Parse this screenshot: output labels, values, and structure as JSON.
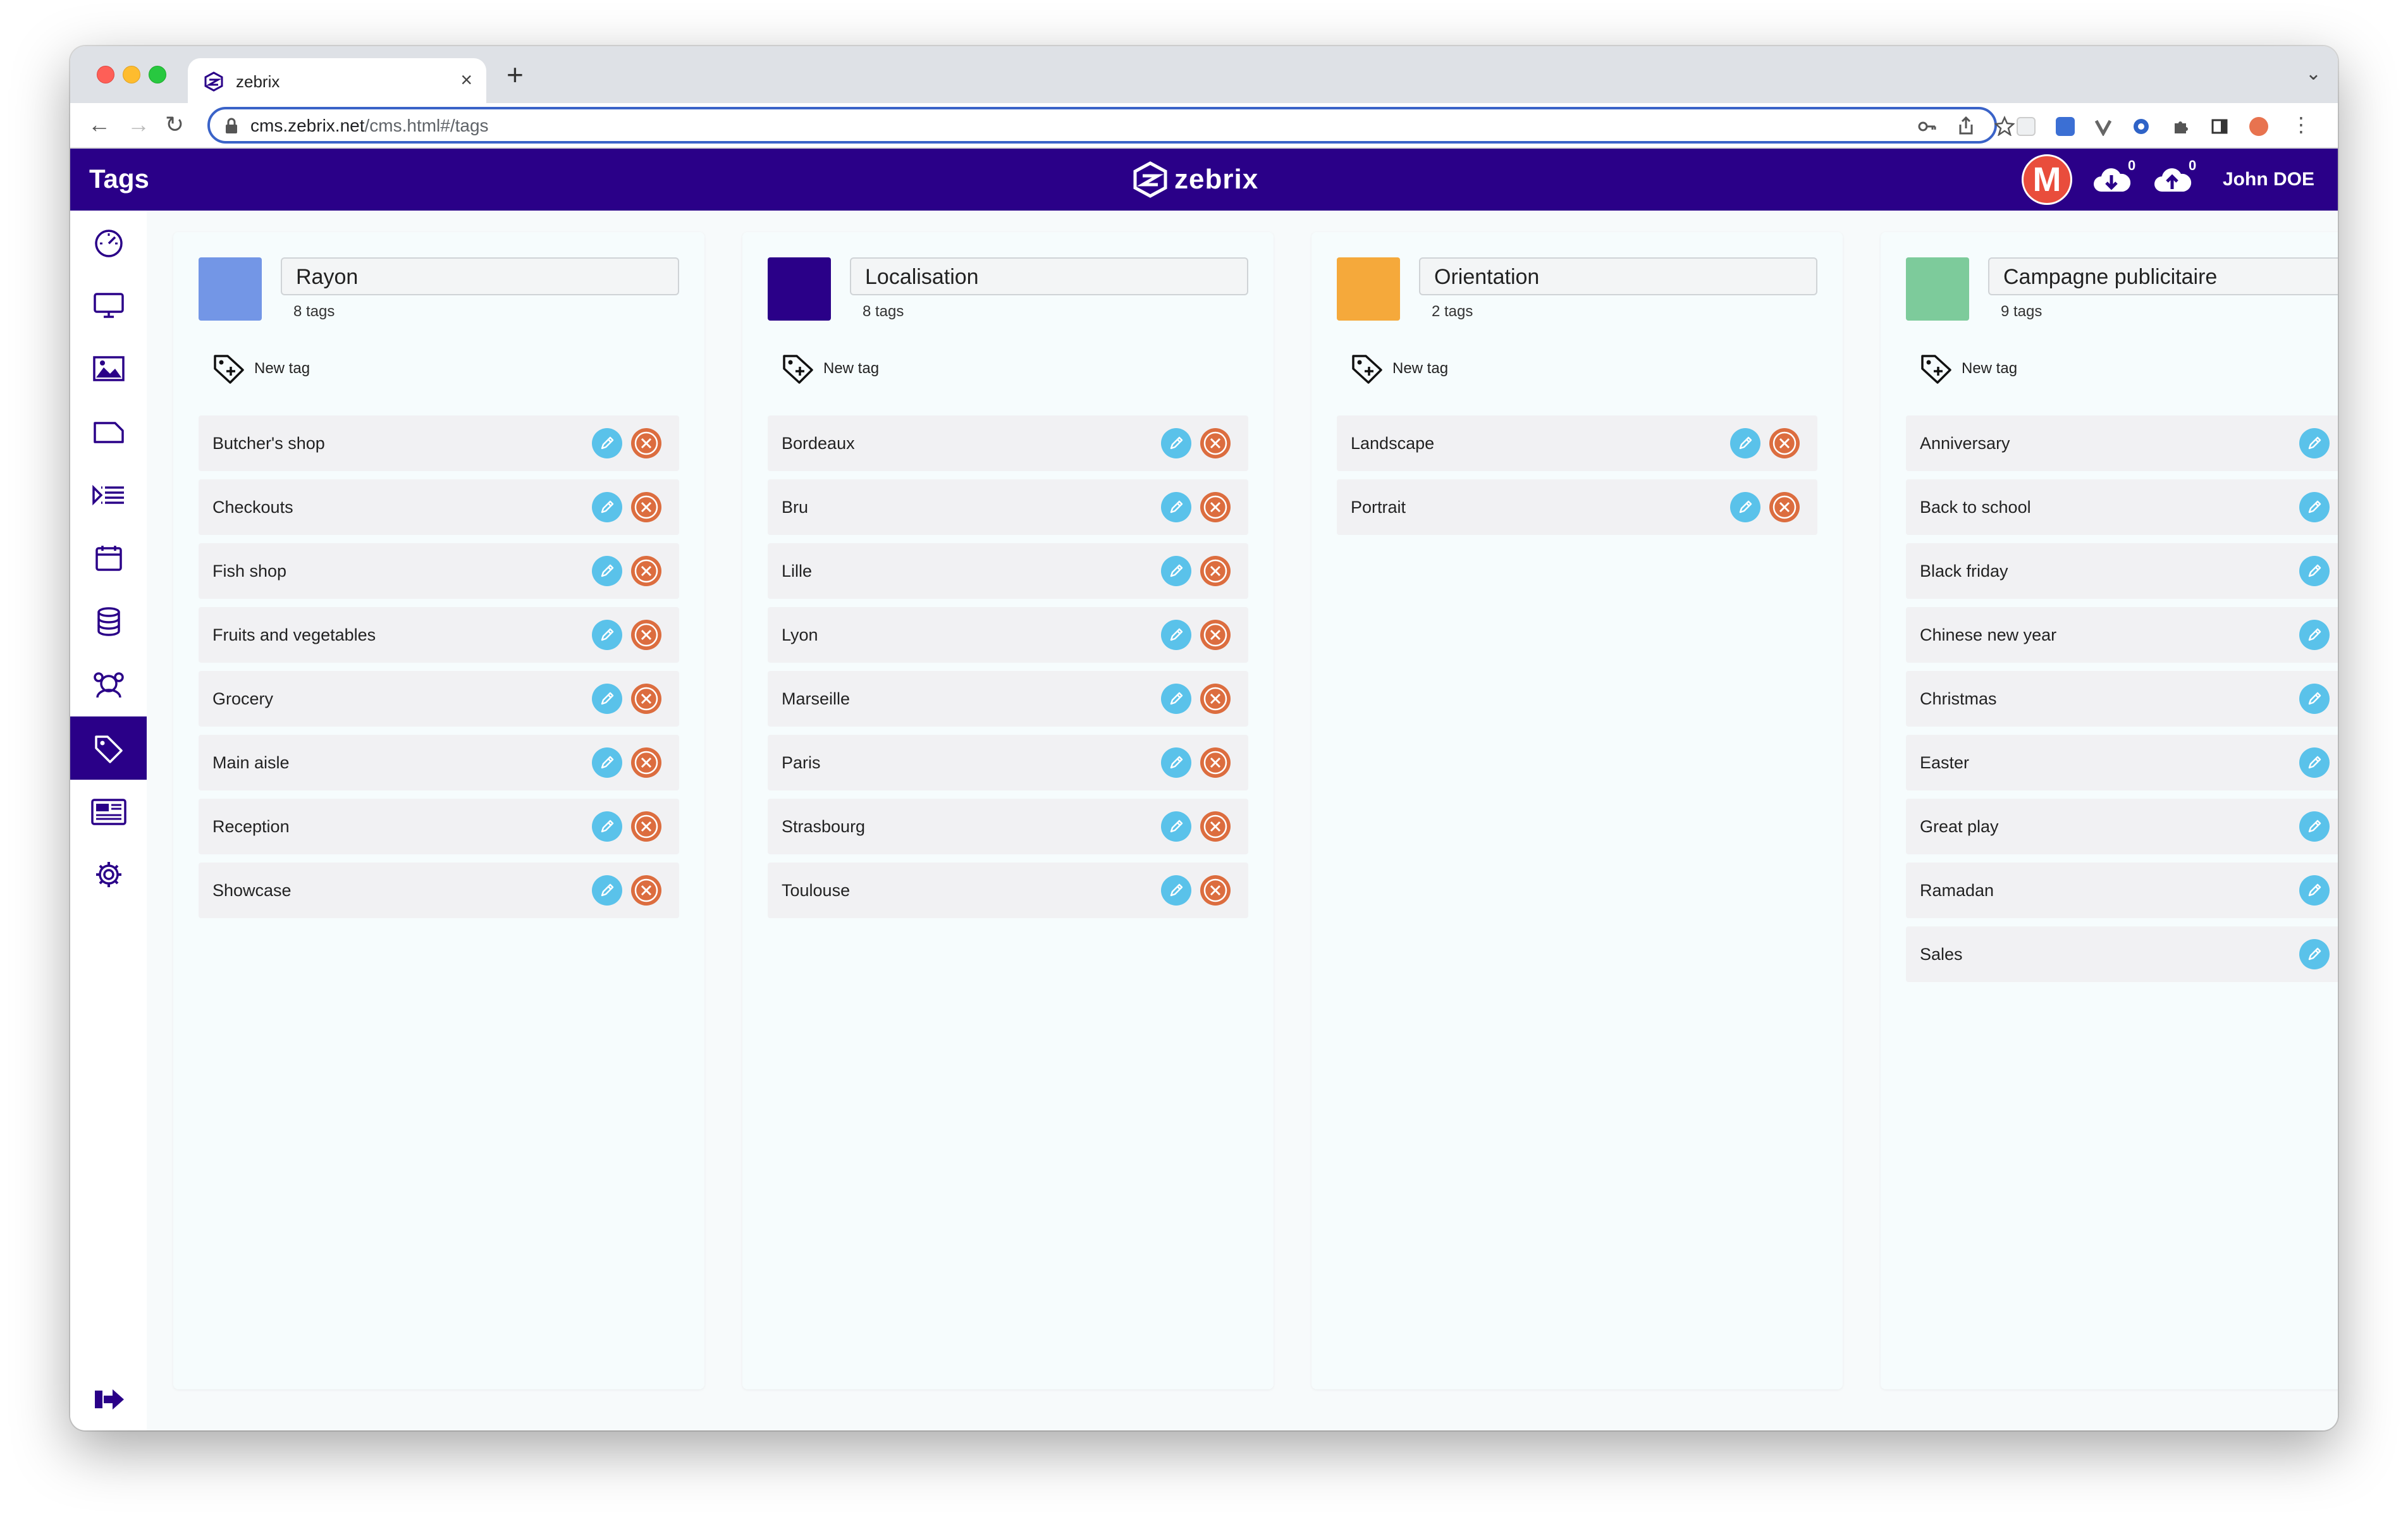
{
  "browser": {
    "tab_title": "zebrix",
    "tab_close": "×",
    "new_tab": "+",
    "url_host": "cms.zebrix.net",
    "url_path": "/cms.html#/tags"
  },
  "header": {
    "title": "Tags",
    "logo_text": "zebrix",
    "avatar_letter": "M",
    "download_count": "0",
    "upload_count": "0",
    "user_name": "John DOE",
    "color": "#2a0088"
  },
  "sidebar": {
    "items": [
      {
        "icon": "dashboard-icon"
      },
      {
        "icon": "monitor-icon"
      },
      {
        "icon": "image-icon"
      },
      {
        "icon": "folder-icon"
      },
      {
        "icon": "playlist-icon"
      },
      {
        "icon": "calendar-icon"
      },
      {
        "icon": "database-icon"
      },
      {
        "icon": "users-icon"
      },
      {
        "icon": "tag-icon",
        "active": true
      },
      {
        "icon": "news-icon"
      },
      {
        "icon": "settings-icon"
      }
    ],
    "logout_icon": "logout-icon"
  },
  "groups": [
    {
      "name": "Rayon",
      "color": "#7396e6",
      "count_label": "8 tags",
      "new_tag_label": "New tag",
      "tags": [
        "Butcher's shop",
        "Checkouts",
        "Fish shop",
        "Fruits and vegetables",
        "Grocery",
        "Main aisle",
        "Reception",
        "Showcase"
      ]
    },
    {
      "name": "Localisation",
      "color": "#2a0088",
      "count_label": "8 tags",
      "new_tag_label": "New tag",
      "tags": [
        "Bordeaux",
        "Bru",
        "Lille",
        "Lyon",
        "Marseille",
        "Paris",
        "Strasbourg",
        "Toulouse"
      ]
    },
    {
      "name": "Orientation",
      "color": "#f5a93b",
      "count_label": "2 tags",
      "new_tag_label": "New tag",
      "tags": [
        "Landscape",
        "Portrait"
      ]
    },
    {
      "name": "Campagne publicitaire",
      "color": "#7dcb9b",
      "count_label": "9 tags",
      "new_tag_label": "New tag",
      "tags": [
        "Anniversary",
        "Back to school",
        "Black friday",
        "Chinese new year",
        "Christmas",
        "Easter",
        "Great play",
        "Ramadan",
        "Sales"
      ]
    }
  ]
}
